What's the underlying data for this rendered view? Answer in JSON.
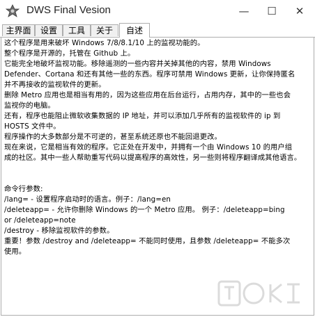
{
  "window": {
    "title": "DWS Final Vesion",
    "minimize_glyph": "—",
    "maximize_glyph": "☐",
    "close_glyph": "✕"
  },
  "tabs": [
    {
      "label": "主界面",
      "active": false
    },
    {
      "label": "设置",
      "active": false
    },
    {
      "label": "工具",
      "active": false
    },
    {
      "label": "关于",
      "active": false
    },
    {
      "label": "自述",
      "active": true
    }
  ],
  "readme": {
    "lines": [
      "这个程序是用来破坏 Windows 7/8/8.1/10 上的监视功能的。",
      "整个程序是开源的，托管在 Github 上。",
      "它能完全地破坏监视功能。移除遥测的一些内容并关掉其他的内容，禁用 Windows",
      "Defender、Cortana 和还有其他一些的东西。程序可禁用 Windows 更新，让你保持匿名",
      "并不再接收的监视软件的更新。",
      "删除 Metro 应用也是相当有用的，因为这些应用在后台运行，占用内存，其中的一些也会",
      "监视你的电脑。",
      "还有，程序也能阻止微软收集数据的 IP 地址，并可以添加几乎所有的监视软件的 ip 到",
      "HOSTS 文件中。",
      "程序操作的大多数部分是不可逆的，甚至系统还原也不能回退更改。",
      "现在来说，它是相当有效的程序。它正处在开发中，并拥有一个由 Windows 10 的用户组",
      "成的社区。其中一些人帮助重写代码以提高程序的高效性，另一些则将程序翻译成其他语言。",
      "",
      "",
      "命令行参数:",
      "/lang= - 设置程序启动时的语言。例子：/lang=en",
      "/deleteapp= - 允许你删除 Windows 的一个 Metro 应用。 例子：/deleteapp=bing",
      "or /deleteapp=note",
      "/destroy - 移除监视软件的参数。",
      "重要！参数 /destroy and /deleteapp= 不能同时使用，且参数 /deleteapp= 不能多次",
      "使用。"
    ]
  },
  "icons": {
    "app": "app-logo-icon"
  },
  "colors": {
    "border": "#adadad",
    "tab_inactive_bg": "#f0f0f0",
    "background": "#ffffff"
  }
}
